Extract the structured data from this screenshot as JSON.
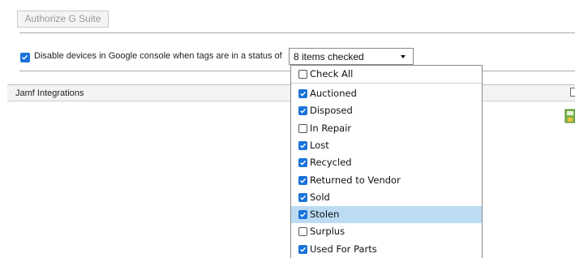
{
  "google": {
    "authorize_label": "Authorize G Suite",
    "disable_label": "Disable devices in Google console when tags are in a status of",
    "disable_checked": true
  },
  "status_select": {
    "value": "8 items checked",
    "check_all_label": "Check All",
    "check_all_checked": false,
    "options": [
      {
        "label": "Auctioned",
        "checked": true
      },
      {
        "label": "Disposed",
        "checked": true
      },
      {
        "label": "In Repair",
        "checked": false
      },
      {
        "label": "Lost",
        "checked": true
      },
      {
        "label": "Recycled",
        "checked": true
      },
      {
        "label": "Returned to Vendor",
        "checked": true
      },
      {
        "label": "Sold",
        "checked": true
      },
      {
        "label": "Stolen",
        "checked": true,
        "highlighted": true
      },
      {
        "label": "Surplus",
        "checked": false
      },
      {
        "label": "Used For Parts",
        "checked": true
      }
    ]
  },
  "jamf": {
    "title": "Jamf Integrations"
  },
  "colors": {
    "checkbox_accent": "#1a73d9",
    "highlight": "#bcdcf4"
  }
}
